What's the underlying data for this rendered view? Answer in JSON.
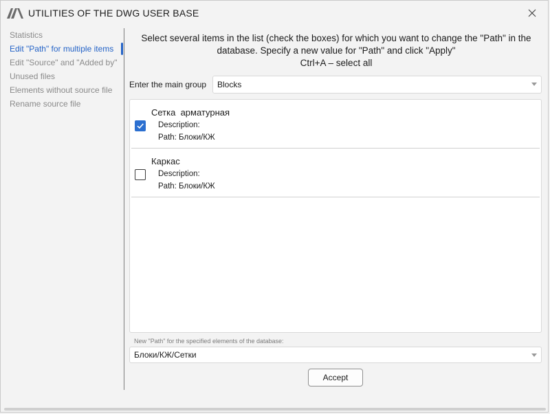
{
  "window": {
    "title": "UTILITIES OF THE DWG USER BASE"
  },
  "sidebar": {
    "items": [
      {
        "label": "Statistics"
      },
      {
        "label": "Edit \"Path\" for multiple items"
      },
      {
        "label": "Edit \"Source\" and \"Added by\""
      },
      {
        "label": "Unused files"
      },
      {
        "label": "Elements without source file"
      },
      {
        "label": "Rename source file"
      }
    ],
    "active_index": 1
  },
  "main": {
    "instructions": {
      "line1": "Select several items in the list (check the boxes) for which you want to change the \"Path\" in the",
      "line2": "database. Specify a new value for \"Path\" and click \"Apply\"",
      "line3": "Ctrl+A – select all"
    },
    "group": {
      "label": "Enter the main group",
      "value": "Blocks"
    },
    "items": [
      {
        "title": "Сетка  арматурная",
        "description": "Description:",
        "path": "Path: Блоки/КЖ",
        "checked": true
      },
      {
        "title": "Каркас",
        "description": "Description:",
        "path": "Path: Блоки/КЖ",
        "checked": false
      }
    ],
    "new_path": {
      "label": "New \"Path\" for the specified elements of the database:",
      "value": "Блоки/КЖ/Сетки"
    },
    "accept_label": "Accept"
  },
  "colors": {
    "accent": "#2463c7",
    "checkbox_on": "#2b6fd0",
    "background": "#f3f3f3"
  }
}
